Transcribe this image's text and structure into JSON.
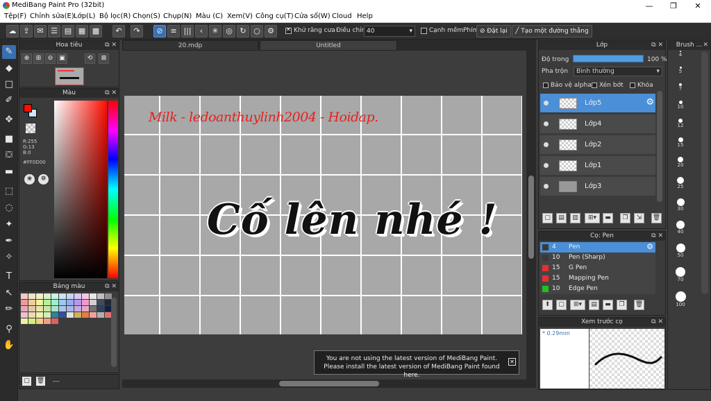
{
  "window": {
    "title": "MediBang Paint Pro (32bit)",
    "minimize": "—",
    "restore": "❐",
    "close": "✕"
  },
  "menu": [
    "Tệp(F)",
    "Chỉnh sửa(E)",
    "Lớp(L)",
    "Bộ lọc(R)",
    "Chọn(S)",
    "Chụp(N)",
    "Màu (C)",
    "Xem(V)",
    "Công cụ(T)",
    "Cửa sổ(W)",
    "Cloud",
    "Help"
  ],
  "toolbar": {
    "antialias_label": "Khử răng cưa",
    "adjust_label": "Điều chỉnh",
    "adjust_value": "40",
    "soft_edge_label": "Cạnh mềm",
    "key_label": "Phím",
    "reset_label": "Đặt lại",
    "line_label": "Tạo một đường thẳng"
  },
  "navigator": {
    "title": "Hoa tiêu"
  },
  "color": {
    "title": "Màu",
    "r": "R:255",
    "g": "G:13",
    "b": "B:0",
    "hex": "#FF0D00",
    "primary": "#ff0d00"
  },
  "palette": {
    "title": "Bảng màu",
    "bottom_text": "---",
    "swatches": [
      "#f2c9c9",
      "#f2e4c9",
      "#f2f2c9",
      "#d9f2c9",
      "#c9f2e4",
      "#c9e4f2",
      "#c9d4f2",
      "#d9c9f2",
      "#f2c9e4",
      "#e8e8e8",
      "#c0c0c0",
      "#909090",
      "#f29999",
      "#f2cc99",
      "#f2f299",
      "#b3f299",
      "#99f2cc",
      "#99ccf2",
      "#99aaf2",
      "#b399f2",
      "#f299cc",
      "#d0d0d0",
      "#404a60",
      "#202838",
      "#e6a8b8",
      "#e6c8a8",
      "#e6e6a8",
      "#c8e6a8",
      "#a8e6c8",
      "#a8c8e6",
      "#a8b8e6",
      "#c8a8e6",
      "#e6a8c8",
      "#707070",
      "#304060",
      "#102040",
      "#f0c0d0",
      "#f0d8b0",
      "#f0f0b0",
      "#d0f0b0",
      "#3080a0",
      "#3050a0",
      "#e0e0e0",
      "#d0b060",
      "#e08040",
      "#f0a0a0",
      "#b0b0b0",
      "#e07070",
      "#f0f0a0",
      "#d0f080",
      "#f0d080",
      "#f0a080",
      "#e06060"
    ]
  },
  "tabs": [
    "20.mdp",
    "Untitled"
  ],
  "canvas": {
    "handwriting": "Milk  - ledoanthuylinh2004 - Hoidap.",
    "lettering": "Cố lên nhé !"
  },
  "notice": {
    "line1": "You are not using the latest version of MediBang Paint.",
    "line2": "Please install the latest version of MediBang Paint found here.",
    "close": "✕"
  },
  "layers": {
    "title": "Lớp",
    "opacity_label": "Độ trong",
    "opacity_value": "100 %",
    "opacity": 1.0,
    "blend_label": "Pha trộn",
    "blend_value": "Bình thường",
    "alpha_protect": "Bảo vệ alpha",
    "clipping": "Xén bớt",
    "lock": "Khóa",
    "items": [
      "Lớp5",
      "Lớp4",
      "Lớp2",
      "Lớp1",
      "Lớp3"
    ]
  },
  "brush": {
    "title": "Cọ: Pen",
    "items": [
      {
        "size": "4",
        "name": "Pen",
        "color": "#3a3a3a"
      },
      {
        "size": "10",
        "name": "Pen (Sharp)",
        "color": "#3a3a3a"
      },
      {
        "size": "15",
        "name": "G Pen",
        "color": "#e83030"
      },
      {
        "size": "15",
        "name": "Mapping Pen",
        "color": "#e83030"
      },
      {
        "size": "10",
        "name": "Edge Pen",
        "color": "#20c020"
      }
    ]
  },
  "preview": {
    "title": "Xem trước cọ",
    "size": "* 0.29mm"
  },
  "brush_size": {
    "title": "Brush ...",
    "sizes": [
      "4",
      "5",
      "7",
      "10",
      "12",
      "15",
      "20",
      "25",
      "30",
      "40",
      "50",
      "70",
      "100"
    ]
  }
}
